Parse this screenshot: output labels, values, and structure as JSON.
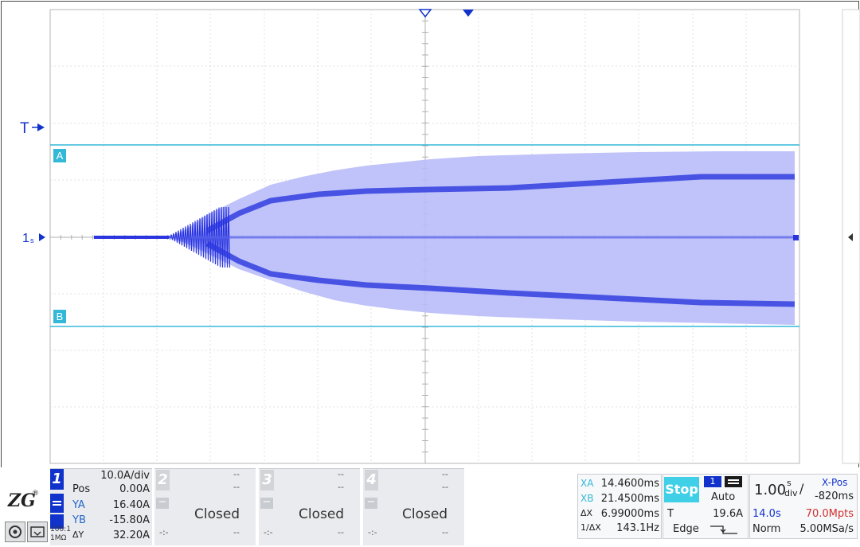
{
  "markers": {
    "trigger_label": "T",
    "channel_marker": "1",
    "cursor_a": "A",
    "cursor_b": "B"
  },
  "channel1": {
    "number": "1",
    "scale": "10.0A/div",
    "pos_label": "Pos",
    "pos_value": "0.00A",
    "ya_label": "YA",
    "ya_value": "16.40A",
    "yb_label": "YB",
    "yb_value": "-15.80A",
    "dy_label": "ΔY",
    "dy_value": "32.20A",
    "probe_ratio": "100:1",
    "impedance": "1MΩ"
  },
  "channels_off": [
    {
      "number": "2",
      "status": "Closed",
      "dash": "--"
    },
    {
      "number": "3",
      "status": "Closed",
      "dash": "--"
    },
    {
      "number": "4",
      "status": "Closed",
      "dash": "--"
    }
  ],
  "cursors": {
    "xa_label": "XA",
    "xa_value": "14.4600ms",
    "xb_label": "XB",
    "xb_value": "21.4500ms",
    "dx_label": "ΔX",
    "dx_value": "6.99000ms",
    "inv_label": "1/ΔX",
    "inv_value": "143.1Hz"
  },
  "trigger": {
    "run_state": "Stop",
    "channel": "1",
    "mode": "Auto",
    "level_label": "T",
    "level_value": "19.6A",
    "type": "Edge"
  },
  "timebase": {
    "scale_value": "1.00",
    "scale_unit_top": "s",
    "scale_unit_bottom": "div",
    "xpos_label": "X-Pos",
    "xpos_value": "-820ms",
    "record_time": "14.0s",
    "memory_depth": "70.0Mpts",
    "acq_mode": "Norm",
    "sample_rate": "5.00MSa/s"
  },
  "colors": {
    "waveform": "#2a35e0",
    "cursor": "#33b8d8",
    "accent": "#1133cc",
    "stop": "#3fd0e8",
    "memory": "#d03030"
  },
  "icons": [
    "zlg-logo",
    "screenshot-icon",
    "save-icon",
    "window-icon",
    "edge-rising-icon",
    "collapse-arrow-icon"
  ]
}
